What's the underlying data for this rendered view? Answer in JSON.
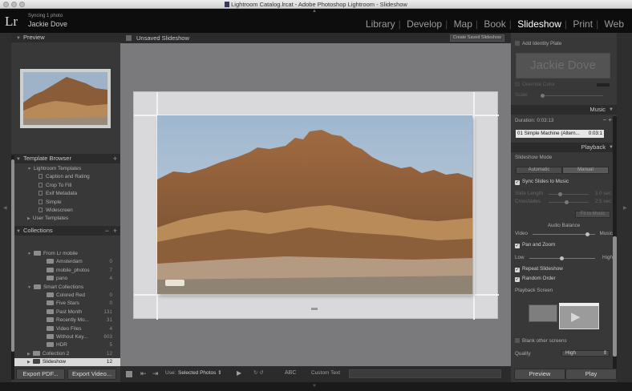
{
  "window": {
    "title": "Lightroom Catalog.lrcat - Adobe Photoshop Lightroom - Slideshow"
  },
  "identity": {
    "sync_status": "Syncing 1 photo",
    "user_name": "Jackie Dove",
    "logo": "Lr"
  },
  "modules": [
    "Library",
    "Develop",
    "Map",
    "Book",
    "Slideshow",
    "Print",
    "Web"
  ],
  "active_module": "Slideshow",
  "left_panel": {
    "preview_header": "Preview",
    "template_browser": {
      "header": "Template Browser",
      "items": [
        {
          "label": "Lightroom Templates",
          "kind": "folder"
        },
        {
          "label": "Caption and Rating",
          "kind": "template"
        },
        {
          "label": "Crop To Fill",
          "kind": "template"
        },
        {
          "label": "Exif Metadata",
          "kind": "template"
        },
        {
          "label": "Simple",
          "kind": "template"
        },
        {
          "label": "Widescreen",
          "kind": "template"
        },
        {
          "label": "User Templates",
          "kind": "folder"
        }
      ]
    },
    "collections": {
      "header": "Collections",
      "items": [
        {
          "label": "From Lr mobile",
          "count": ""
        },
        {
          "label": "Amsterdam",
          "count": "0"
        },
        {
          "label": "mobile_photos",
          "count": "7"
        },
        {
          "label": "pano",
          "count": "4"
        },
        {
          "label": "Smart Collections",
          "count": ""
        },
        {
          "label": "Colored Red",
          "count": "0"
        },
        {
          "label": "Five Stars",
          "count": "0"
        },
        {
          "label": "Past Month",
          "count": "131"
        },
        {
          "label": "Recently Mo...",
          "count": "31"
        },
        {
          "label": "Video Files",
          "count": "4"
        },
        {
          "label": "Without Key...",
          "count": "603"
        },
        {
          "label": "HDR",
          "count": "5"
        },
        {
          "label": "Collection 2",
          "count": "12"
        },
        {
          "label": "Slideshow",
          "count": "12"
        }
      ]
    },
    "export_pdf_label": "Export PDF...",
    "export_video_label": "Export Video..."
  },
  "center": {
    "title": "Unsaved Slideshow",
    "create_saved_label": "Create Saved Slideshow"
  },
  "filmstrip_toolbar": {
    "use_label": "Use:",
    "use_value": "Selected Photos",
    "abc_label": "ABC",
    "custom_text_label": "Custom Text"
  },
  "right_panel": {
    "identity_plate": {
      "label": "Add Identity Plate",
      "plate_text": "Jackie Dove",
      "override_label": "Override Color",
      "scale_label": "Scale"
    },
    "music": {
      "header": "Music",
      "duration_label": "Duration:",
      "duration_value": "0:03:13",
      "track": "01 Simple Machine (Altern...",
      "track_time": "0:03:1"
    },
    "playback": {
      "header": "Playback",
      "mode_label": "Slideshow Mode",
      "automatic_label": "Automatic",
      "manual_label": "Manual",
      "sync_label": "Sync Slides to Music",
      "slide_length_label": "Slide Length",
      "crossfades_label": "Crossfades",
      "slide_length_value": "3.0 sec",
      "crossfades_value": "2.5 sec",
      "fit_button": "Fit to Music",
      "audio_balance_label": "Audio Balance",
      "video_label": "Video",
      "music_label": "Music",
      "pan_zoom_label": "Pan and Zoom",
      "low_label": "Low",
      "high_label": "High",
      "repeat_label": "Repeat Slideshow",
      "random_label": "Random Order",
      "screen_label": "Playback Screen",
      "blank_label": "Blank other screens",
      "quality_label": "Quality",
      "quality_value": "High"
    },
    "preview_button": "Preview",
    "play_button": "Play"
  },
  "colors": {
    "accent": "#ffffff",
    "panel": "#383838",
    "header": "#2b2b2b",
    "canvas": "#7a797b"
  }
}
